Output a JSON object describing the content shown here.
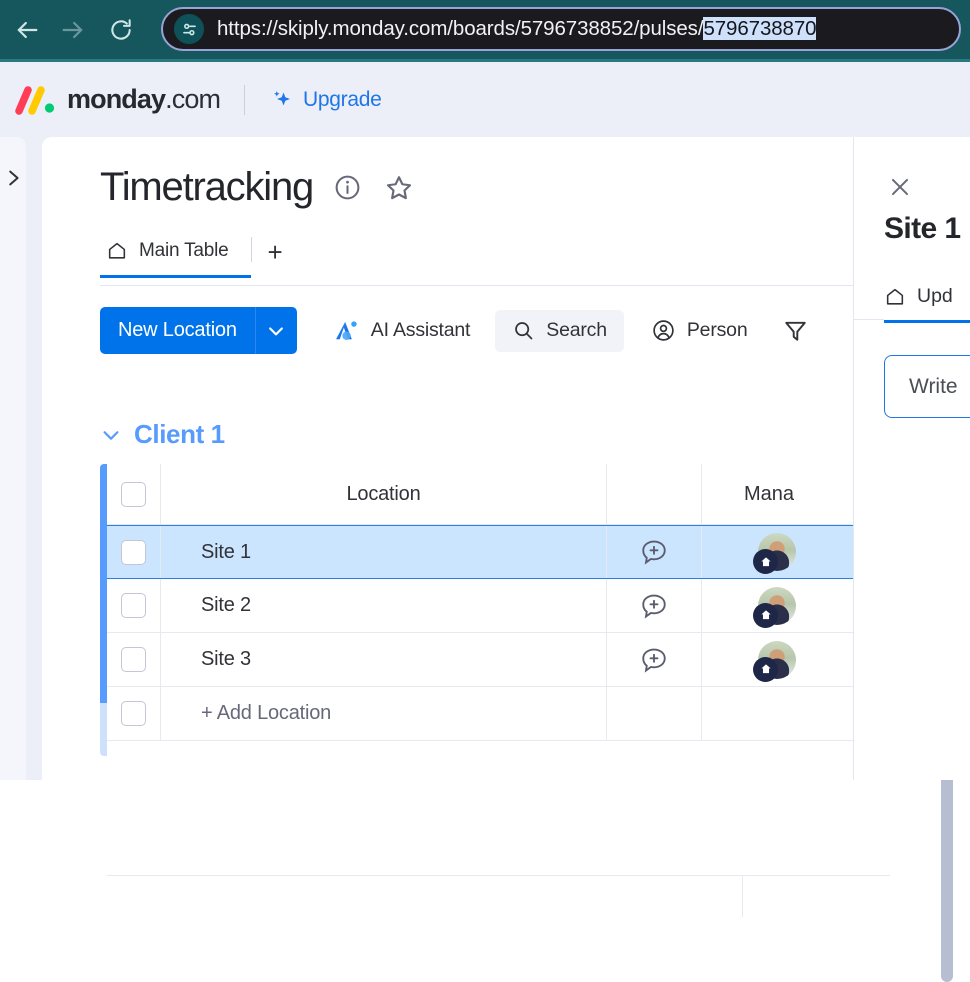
{
  "browser": {
    "back_icon": "arrow-left-icon",
    "forward_icon": "arrow-right-icon",
    "reload_icon": "reload-icon",
    "site_settings_icon": "site-settings-icon",
    "url_prefix": "https://skiply.monday.com/boards/5796738852/pulses/",
    "url_selected": "5796738870",
    "url_full": "https://skiply.monday.com/boards/5796738852/pulses/5796738870",
    "chrome_color": "#16575d",
    "selection_color": "#cfe0fb"
  },
  "header": {
    "logo_name": "monday-logo",
    "brand_bold": "monday",
    "brand_light": ".com",
    "upgrade_label": "Upgrade",
    "upgrade_icon": "sparkle-icon",
    "upgrade_color": "#1f76e8",
    "background": "#eceff8"
  },
  "sidebar": {
    "toggle_icon": "chevron-right-icon"
  },
  "board": {
    "title": "Timetracking",
    "info_icon": "info-circle-icon",
    "favorite_icon": "star-outline-icon",
    "tabs": [
      {
        "label": "Main Table",
        "icon": "home-icon",
        "active": true
      }
    ],
    "add_tab_label": "+",
    "accent_color": "#0073ea"
  },
  "toolbar": {
    "new_item_label": "New Location",
    "new_item_caret_icon": "chevron-down-icon",
    "new_item_color": "#0073ea",
    "items": [
      {
        "label": "AI Assistant",
        "icon": "ai-assistant-icon"
      },
      {
        "label": "Search",
        "icon": "search-icon"
      },
      {
        "label": "Person",
        "icon": "person-circle-icon"
      }
    ],
    "filter_icon": "filter-funnel-icon"
  },
  "group": {
    "name": "Client 1",
    "caret_icon": "chevron-down-icon",
    "color": "#579bfc"
  },
  "table": {
    "columns": [
      "Location",
      "Mana"
    ],
    "column_location": "Location",
    "column_manager_truncated": "Mana",
    "add_note_icon": "add-comment-icon",
    "checkbox_icon": "checkbox-unchecked-icon",
    "avatar_badge_icon": "home-icon",
    "rows": [
      {
        "location": "Site 1",
        "selected": true
      },
      {
        "location": "Site 2",
        "selected": false
      },
      {
        "location": "Site 3",
        "selected": false
      }
    ],
    "add_row_label": "+ Add Location",
    "selected_row_background": "#cce5ff",
    "scrollbar": "vertical-scrollbar"
  },
  "panel": {
    "close_icon": "close-icon",
    "title": "Site 1",
    "tab_label": "Upd",
    "tab_icon": "home-icon",
    "write_placeholder": "Write",
    "accent_color": "#0073ea"
  }
}
